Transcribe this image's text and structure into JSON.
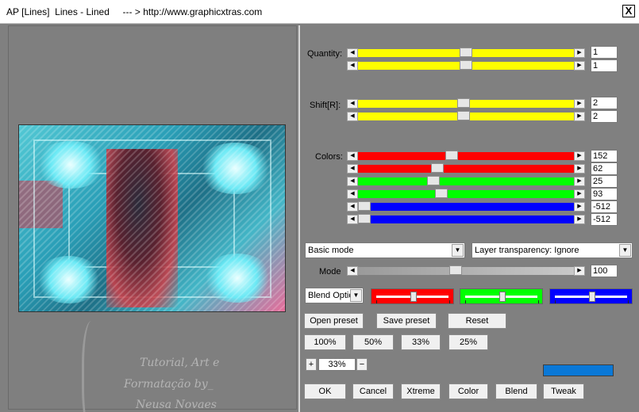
{
  "window": {
    "title": "AP [Lines]  Lines - Lined     --- > http://www.graphicxtras.com",
    "close_label": "X"
  },
  "watermark": {
    "line1": "Tutorial, Art e",
    "line2": "Formatação by_",
    "line3": "Neusa Novaes"
  },
  "quantity": {
    "label": "Quantity:",
    "values": [
      "1",
      "1"
    ],
    "positions": [
      0.5,
      0.5
    ]
  },
  "shift": {
    "label": "Shift[R]:",
    "values": [
      "2",
      "2"
    ],
    "positions": [
      0.49,
      0.49
    ]
  },
  "colors": {
    "label": "Colors:",
    "rows": [
      {
        "value": "152",
        "position": 0.43,
        "color": "#ff0000"
      },
      {
        "value": "62",
        "position": 0.36,
        "color": "#ff0000"
      },
      {
        "value": "25",
        "position": 0.34,
        "color": "#00ff00"
      },
      {
        "value": "93",
        "position": 0.38,
        "color": "#00ff00"
      },
      {
        "value": "-512",
        "position": 0.0,
        "color": "#0000ff"
      },
      {
        "value": "-512",
        "position": 0.0,
        "color": "#0000ff"
      }
    ]
  },
  "mode_select": {
    "value": "Basic mode"
  },
  "transparency_select": {
    "value": "Layer transparency: Ignore"
  },
  "mode": {
    "label": "Mode",
    "value": "100",
    "position": 0.45
  },
  "blend_select": {
    "value": "Blend Optio"
  },
  "blend_sliders": [
    {
      "color": "#ff0000",
      "position": 0.5
    },
    {
      "color": "#00ff00",
      "position": 0.5
    },
    {
      "color": "#0000ff",
      "position": 0.5
    }
  ],
  "presets": {
    "open": "Open preset",
    "save": "Save preset",
    "reset": "Reset"
  },
  "zoom_buttons": [
    "100%",
    "50%",
    "33%",
    "25%"
  ],
  "zoom": {
    "plus": "+",
    "value": "33%",
    "minus": "−"
  },
  "color_swatch": "#0a78d7",
  "bottom_buttons": [
    "OK",
    "Cancel",
    "Xtreme",
    "Color",
    "Blend",
    "Tweak"
  ]
}
